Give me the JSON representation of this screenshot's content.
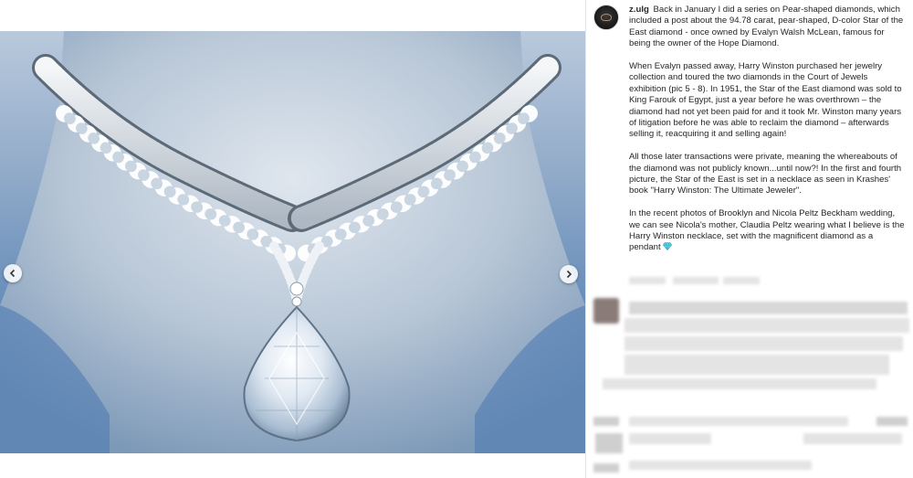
{
  "post": {
    "username": "z.ulg",
    "caption_paragraphs": [
      "Back in January I did a series on Pear-shaped diamonds, which included a post about the 94.78 carat, pear-shaped, D-color Star of the East diamond - once owned by Evalyn Walsh McLean, famous for being the owner of the Hope Diamond.",
      "When Evalyn passed away, Harry Winston purchased her jewelry collection and toured the two diamonds in the Court of Jewels exhibition (pic 5 - 8). In 1951, the Star of the East diamond was sold to King Farouk of Egypt, just a year before he was overthrown – the diamond had not yet been paid for and it took Mr. Winston many years of litigation before he was able to reclaim the diamond – afterwards selling it, reacquiring it and selling again!",
      "All those later transactions were private, meaning the whereabouts of the diamond was not publicly known...until now?! In the first and fourth picture, the Star of the East is set in a necklace as seen in Krashes' book \"Harry Winston: The Ultimate Jeweler\".",
      "In the recent photos of Brooklyn and Nicola Peltz Beckham wedding, we can see Nicola's mother, Claudia Peltz wearing what I believe is the Harry Winston necklace, set with the magnificent diamond as a pendant"
    ],
    "gem_emoji": "gem-icon"
  },
  "media": {
    "prev_icon": "chevron-left-icon",
    "next_icon": "chevron-right-icon"
  },
  "colors": {
    "text": "#262626",
    "background": "#ffffff",
    "backdrop_blue": "#5f88b8"
  }
}
